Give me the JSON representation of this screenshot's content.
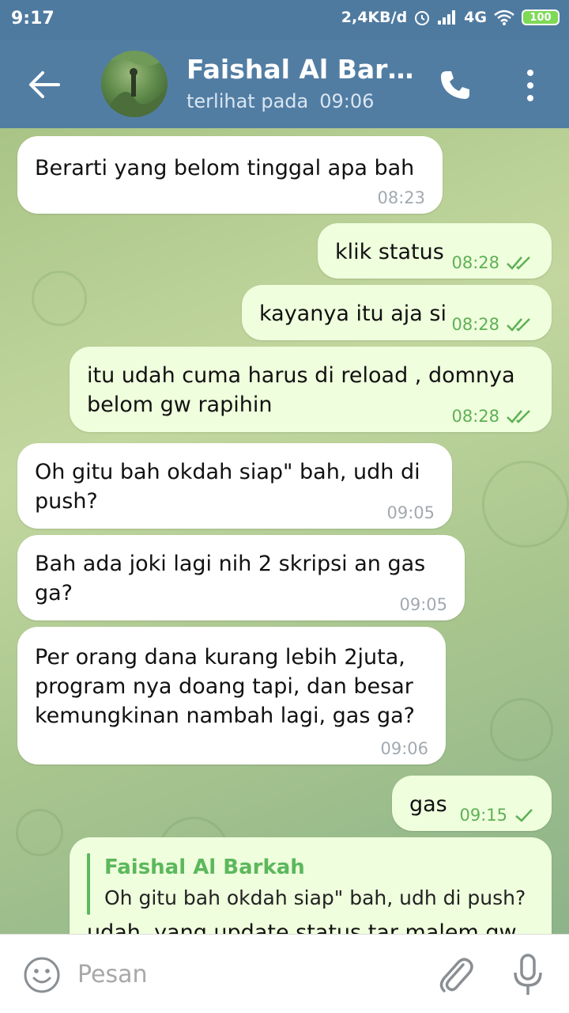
{
  "status_bar": {
    "time": "9:17",
    "network_speed": "2,4KB/d",
    "network_type": "4G",
    "battery": "100"
  },
  "header": {
    "title": "Faishal Al Bark…",
    "subtitle_prefix": "terlihat pada",
    "last_seen_time": "09:06",
    "back_icon": "arrow-left-icon",
    "call_icon": "phone-icon",
    "menu_icon": "more-vertical-icon"
  },
  "messages": [
    {
      "direction": "in",
      "text": "Berarti yang belom tinggal apa bah",
      "time": "08:23"
    },
    {
      "direction": "out",
      "text": "klik status",
      "time": "08:28",
      "status": "read"
    },
    {
      "direction": "out",
      "text": "kayanya itu aja si",
      "time": "08:28",
      "status": "read"
    },
    {
      "direction": "out",
      "text": "itu udah cuma harus di reload , domnya belom gw rapihin",
      "time": "08:28",
      "status": "read"
    },
    {
      "direction": "in",
      "text": "Oh gitu bah okdah siap\" bah, udh di push?",
      "time": "09:05"
    },
    {
      "direction": "in",
      "text": "Bah ada joki lagi nih 2 skripsi an gas ga?",
      "time": "09:05"
    },
    {
      "direction": "in",
      "text": "Per orang dana kurang lebih 2juta, program nya doang tapi, dan besar kemungkinan nambah lagi, gas ga?",
      "time": "09:06"
    },
    {
      "direction": "out",
      "text": "gas",
      "time": "09:15",
      "status": "sent"
    },
    {
      "direction": "out",
      "reply_to": {
        "name": "Faishal Al Barkah",
        "text": "Oh gitu bah okdah siap\" bah, udh di push?"
      },
      "text": "udah, yang update status tar malem gw"
    }
  ],
  "input": {
    "placeholder": "Pesan",
    "value": ""
  },
  "colors": {
    "header": "#527da3",
    "outgoing_bubble": "#effedd",
    "incoming_bubble": "#ffffff",
    "time_outgoing": "#5fb055",
    "reply_accent": "#5cb85c"
  }
}
